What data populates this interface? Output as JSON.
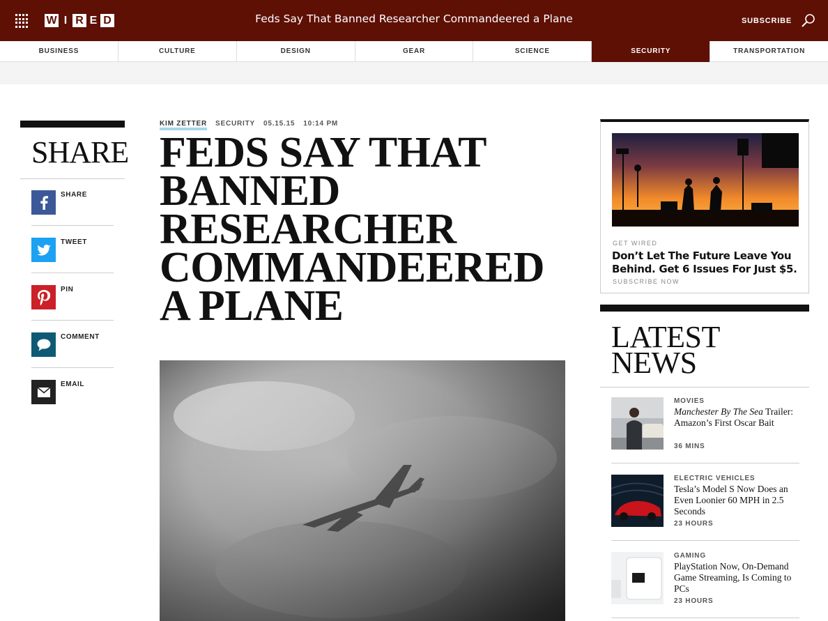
{
  "header": {
    "logo_letters": [
      "W",
      "I",
      "R",
      "E",
      "D"
    ],
    "title": "Feds Say That Banned Researcher Commandeered a Plane",
    "subscribe_label": "SUBSCRIBE",
    "brand_color": "#5e1005"
  },
  "nav": {
    "tabs": [
      "BUSINESS",
      "CULTURE",
      "DESIGN",
      "GEAR",
      "SCIENCE",
      "SECURITY",
      "TRANSPORTATION"
    ],
    "active": "SECURITY"
  },
  "share": {
    "heading": "SHARE",
    "items": [
      {
        "label": "SHARE",
        "icon": "facebook-icon",
        "color": "#3b5998"
      },
      {
        "label": "TWEET",
        "icon": "twitter-icon",
        "color": "#1da1f2"
      },
      {
        "label": "PIN",
        "icon": "pinterest-icon",
        "color": "#cb2027"
      },
      {
        "label": "COMMENT",
        "icon": "comment-icon",
        "color": "#0e5a75"
      },
      {
        "label": "EMAIL",
        "icon": "email-icon",
        "color": "#222222"
      }
    ]
  },
  "article": {
    "author": "KIM ZETTER",
    "section": "SECURITY",
    "date": "05.15.15",
    "time": "10:14 PM",
    "headline": "FEDS SAY THAT BANNED RESEARCHER COMMANDEERED A PLANE"
  },
  "ad": {
    "kicker": "GET WIRED",
    "text": "Don’t Let The Future Leave You Behind. Get 6 Issues For Just $5.",
    "cta": "SUBSCRIBE NOW"
  },
  "latest": {
    "heading_line1": "LATEST",
    "heading_line2": "NEWS",
    "items": [
      {
        "category": "MOVIES",
        "title_italic": "Manchester By The Sea",
        "title_rest": " Trailer: Amazon’s First Oscar Bait",
        "time": "36 MINS"
      },
      {
        "category": "ELECTRIC VEHICLES",
        "title_italic": "",
        "title_rest": "Tesla’s Model S Now Does an Even Loonier 60 MPH in 2.5 Seconds",
        "time": "23 HOURS"
      },
      {
        "category": "GAMING",
        "title_italic": "",
        "title_rest": "PlayStation Now, On-Demand Game Streaming, Is Coming to PCs",
        "time": "23 HOURS"
      }
    ]
  }
}
